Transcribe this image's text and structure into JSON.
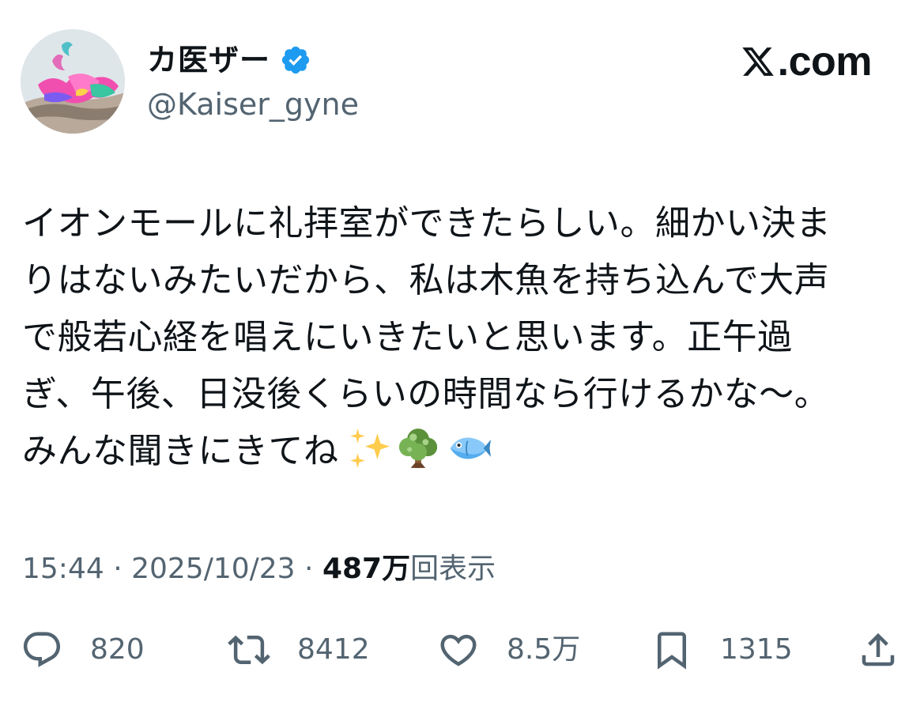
{
  "user": {
    "display_name": "カ医ザー",
    "handle": "@Kaiser_gyne",
    "verified_icon": "verified-badge-icon",
    "verified_color": "#1d9bf0"
  },
  "brand": {
    "text": ".com",
    "logo": "x-logo-icon"
  },
  "tweet": {
    "lines": [
      "イオンモールに礼拝室ができたらしい。細かい決ま",
      "りはないみたいだから、私は木魚を持ち込んで大声",
      "で般若心経を唱えにいきたいと思います。正午過",
      "ぎ、午後、日没後くらいの時間なら行けるかな〜。",
      "みんな聞きにきてね"
    ],
    "emojis": [
      "sparkles-emoji",
      "tree-emoji",
      "fish-emoji"
    ]
  },
  "meta": {
    "time": "15:44",
    "separator": " · ",
    "date": "2025/10/23",
    "views_count": "487万",
    "views_label": "回表示"
  },
  "actions": {
    "reply": {
      "count": "820",
      "icon": "reply-icon"
    },
    "retweet": {
      "count": "8412",
      "icon": "retweet-icon"
    },
    "like": {
      "count": "8.5万",
      "icon": "heart-icon"
    },
    "bookmark": {
      "count": "1315",
      "icon": "bookmark-icon"
    },
    "share": {
      "icon": "share-icon"
    }
  },
  "colors": {
    "text_primary": "#0f1419",
    "text_secondary": "#536471",
    "background": "#ffffff"
  }
}
